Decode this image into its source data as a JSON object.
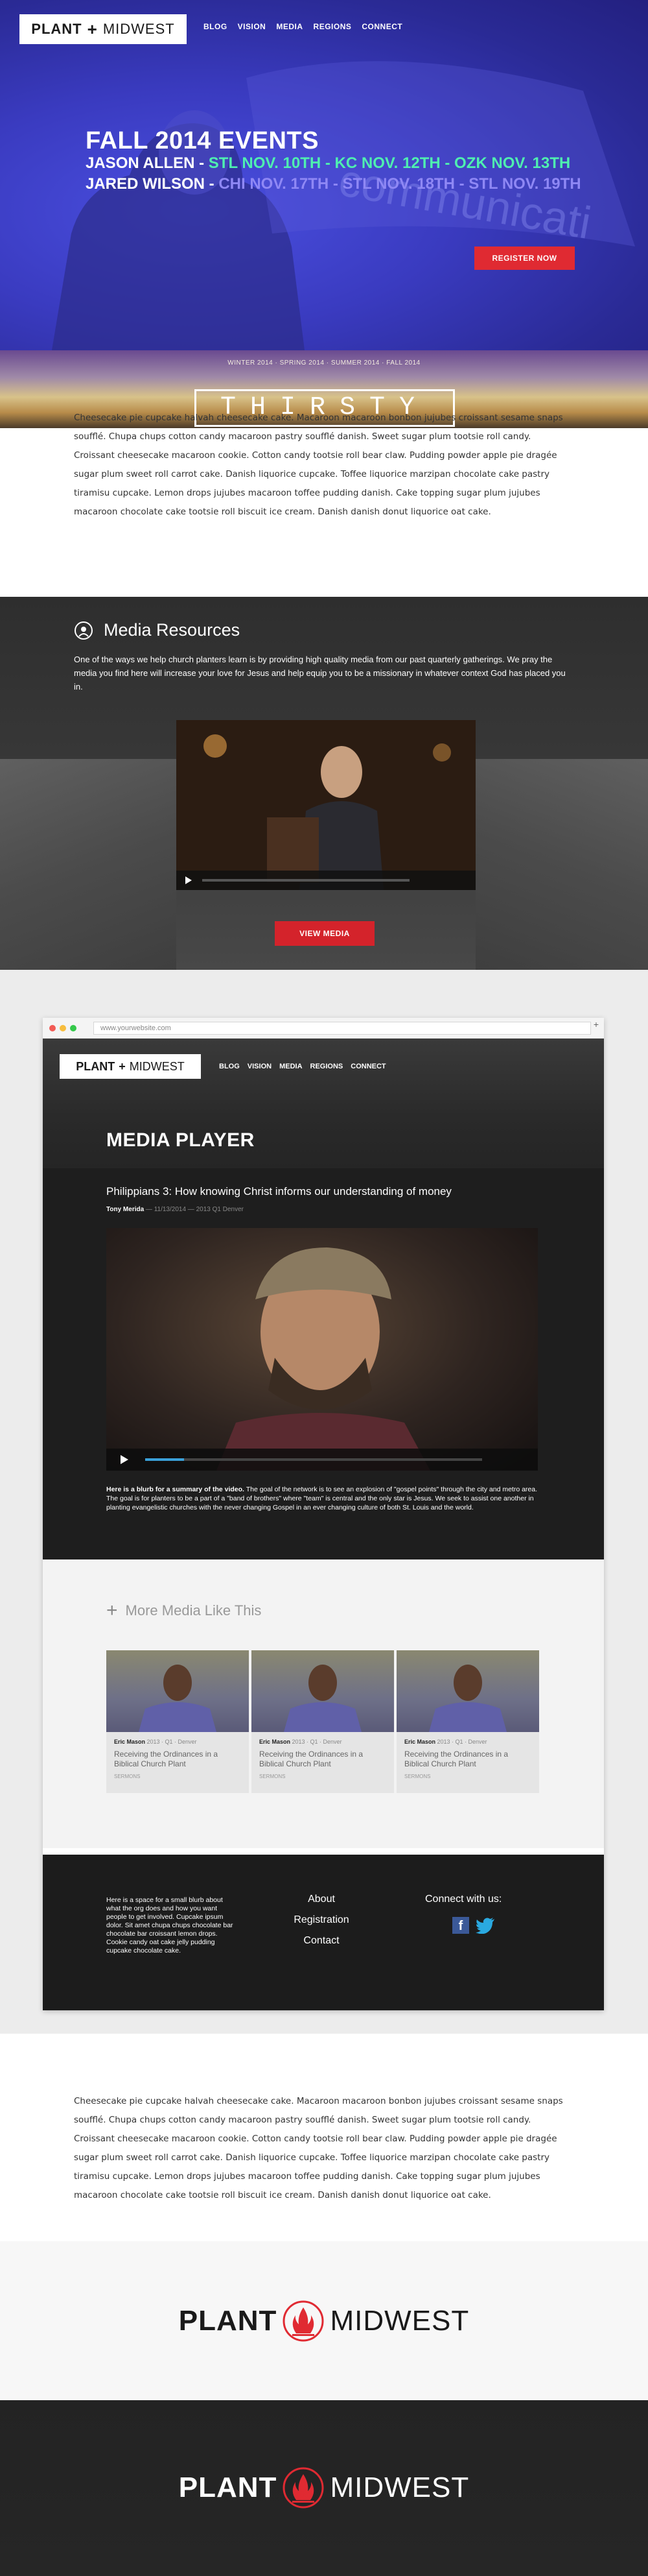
{
  "hero": {
    "logo_bold": "PLANT",
    "logo_cross": "+",
    "logo_light": "MIDWEST",
    "nav": [
      "BLOG",
      "VISION",
      "MEDIA",
      "REGIONS",
      "CONNECT"
    ],
    "title": "FALL 2014 EVENTS",
    "line1": {
      "name": "JASON ALLEN -",
      "events": [
        {
          "text": "STL NOV. 10TH -",
          "color": "#4ff0b0"
        },
        {
          "text": "KC NOV. 12TH -",
          "color": "#4ff0b0"
        },
        {
          "text": "OZK NOV. 13TH",
          "color": "#4ff0b0"
        }
      ]
    },
    "line2": {
      "name": "JARED WILSON -",
      "events": [
        {
          "text": "CHI NOV. 17TH -",
          "color": "#8f88f5"
        },
        {
          "text": "STL NOV. 18TH -",
          "color": "#8f88f5"
        },
        {
          "text": "STL NOV. 19TH",
          "color": "#8f88f5"
        }
      ]
    },
    "register_label": "REGISTER NOW",
    "register_color": "#e02a32"
  },
  "band": {
    "seasons": "WINTER 2014 · SPRING 2014 · SUMMER 2014 · FALL 2014",
    "word": "THIRSTY"
  },
  "lorem": "Cheesecake pie cupcake halvah cheesecake cake. Macaroon macaroon bonbon jujubes croissant sesame snaps soufflé. Chupa chups cotton candy macaroon pastry soufflé danish. Sweet sugar plum tootsie roll candy. Croissant cheesecake macaroon cookie. Cotton candy tootsie roll bear claw. Pudding powder apple pie dragée sugar plum sweet roll carrot cake. Danish liquorice cupcake. Toffee liquorice marzipan chocolate cake pastry tiramisu cupcake. Lemon drops jujubes macaroon toffee pudding danish. Cake topping sugar plum jujubes macaroon chocolate cake tootsie roll biscuit ice cream. Danish danish donut liquorice oat cake.",
  "media_resources": {
    "title": "Media Resources",
    "icon": "broadcast-icon",
    "text": "One of the ways we help church planters learn is by providing high quality media from our past quarterly gatherings. We pray the media you find here will increase your love for Jesus and help equip you to be a missionary in whatever context God has placed you in.",
    "button": "VIEW MEDIA",
    "button_color": "#d4232b"
  },
  "browser": {
    "url": "www.yourwebsite.com",
    "nav": [
      "BLOG",
      "VISION",
      "MEDIA",
      "REGIONS",
      "CONNECT"
    ],
    "page_title": "MEDIA PLAYER",
    "video_title": "Philippians 3: How knowing Christ informs our understanding of money",
    "author": "Tony Merida",
    "meta": " — 11/13/2014 — 2013 Q1 Denver",
    "blurb_bold": "Here is a blurb for a summary of the video.",
    "blurb": " The goal of the network is to see an explosion of \"gospel points\" through the city and metro area. The goal is for planters to be a part of a \"band of brothers\" where \"team\" is central and the only star is Jesus. We seek to assist one another in planting evangelistic churches with the never changing Gospel in an ever changing culture of both St. Louis and the world.",
    "more_title": "More Media Like This",
    "cards": [
      {
        "name": "Eric Mason",
        "meta": "  2013 · Q1 · Denver",
        "title": "Receiving the Ordinances in a Biblical Church Plant",
        "category": "Sermons"
      },
      {
        "name": "Eric Mason",
        "meta": "  2013 · Q1 · Denver",
        "title": "Receiving the Ordinances in a Biblical Church Plant",
        "category": "Sermons"
      },
      {
        "name": "Eric Mason",
        "meta": "  2013 · Q1 · Denver",
        "title": "Receiving the Ordinances in a Biblical Church Plant",
        "category": "Sermons"
      }
    ],
    "footer_blurb": "Here is a space for a small blurb about what the org does and how you want people to get involved. Cupcake ipsum dolor. Sit amet chupa chups chocolate bar chocolate bar croissant lemon drops. Cookie candy oat cake jelly pudding cupcake chocolate cake.",
    "footer_links": [
      "About",
      "Registration",
      "Contact"
    ],
    "connect": "Connect with us:"
  },
  "brand": {
    "bold": "PLANT",
    "light": "MIDWEST",
    "flame_color": "#e02a32"
  }
}
